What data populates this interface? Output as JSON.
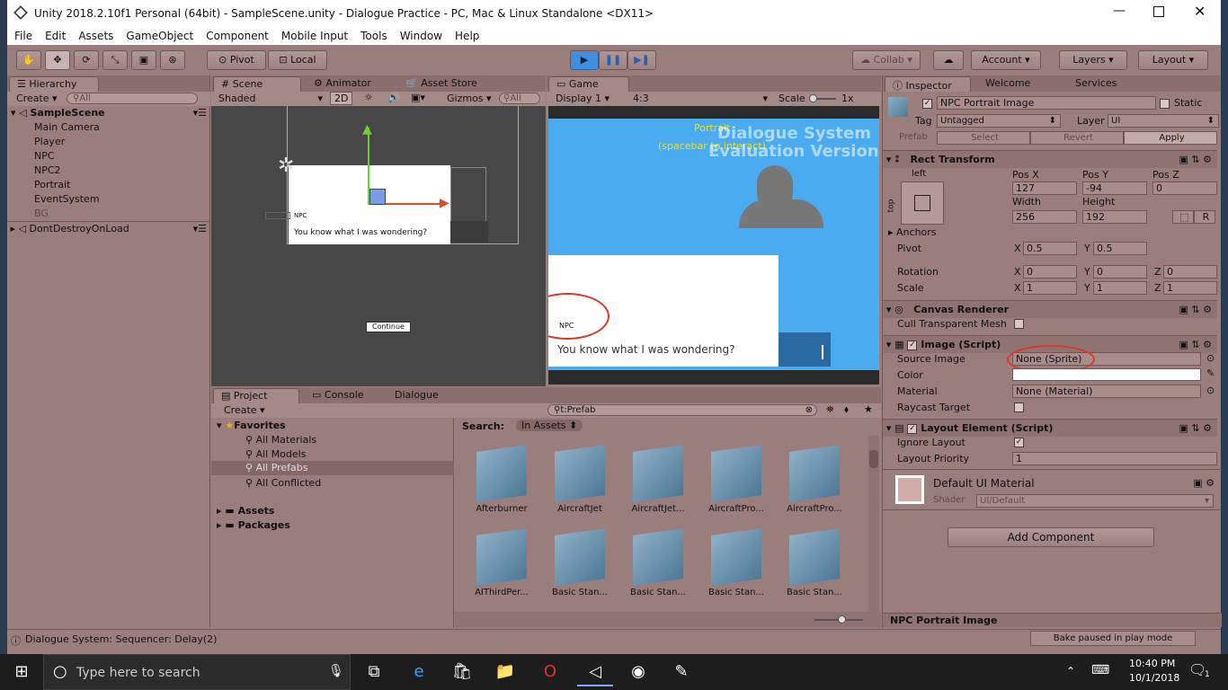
{
  "window": {
    "title": "Unity 2018.2.10f1 Personal (64bit) - SampleScene.unity - Dialogue Practice - PC, Mac & Linux Standalone <DX11>"
  },
  "menu": [
    "File",
    "Edit",
    "Assets",
    "GameObject",
    "Component",
    "Mobile Input",
    "Tools",
    "Window",
    "Help"
  ],
  "toolbar": {
    "pivot": "Pivot",
    "local": "Local",
    "collab": "Collab",
    "account": "Account",
    "layers": "Layers",
    "layout": "Layout"
  },
  "hierarchy": {
    "tab": "Hierarchy",
    "create": "Create",
    "search": "All",
    "scene": "SampleScene",
    "items": [
      "Main Camera",
      "Player",
      "NPC",
      "NPC2",
      "Portrait",
      "EventSystem",
      "BG"
    ],
    "dontdestroy": "DontDestroyOnLoad"
  },
  "scene": {
    "tabs": [
      "Scene",
      "Animator",
      "Asset Store"
    ],
    "shaded": "Shaded",
    "mode2d": "2D",
    "gizmos": "Gizmos",
    "search": "All",
    "npc_label": "NPC",
    "dialog_text": "You know what I was wondering?",
    "continue": "Continue"
  },
  "game": {
    "tab": "Game",
    "display": "Display 1",
    "aspect": "4:3",
    "scale_label": "Scale",
    "scale_value": "1x",
    "portrait": "Portrait",
    "hint": "(spacebar to interact)",
    "watermark1": "Dialogue System",
    "watermark2": "Evaluation Version",
    "npc_label": "NPC",
    "dialog_text": "You know what I was wondering?"
  },
  "project": {
    "tabs": [
      "Project",
      "Console",
      "Dialogue"
    ],
    "create": "Create",
    "search": "t:Prefab",
    "search_label": "Search:",
    "search_scope": "In Assets",
    "favorites": "Favorites",
    "fav_items": [
      "All Materials",
      "All Models",
      "All Prefabs",
      "All Conflicted"
    ],
    "assets": "Assets",
    "packages": "Packages",
    "grid": [
      "Afterburner",
      "AircraftJet",
      "AircraftJet...",
      "AircraftPro...",
      "AircraftPro...",
      "AIThirdPer...",
      "Basic Stan...",
      "Basic Stan...",
      "Basic Stan...",
      "Basic Stan..."
    ]
  },
  "inspector": {
    "tabs": [
      "Inspector",
      "Welcome",
      "Services"
    ],
    "name": "NPC Portrait Image",
    "static": "Static",
    "tag_label": "Tag",
    "tag": "Untagged",
    "layer_label": "Layer",
    "layer": "UI",
    "prefab": "Prefab",
    "select": "Select",
    "revert": "Revert",
    "apply": "Apply",
    "rect": {
      "title": "Rect Transform",
      "anchor_h": "left",
      "anchor_v": "top",
      "posx_label": "Pos X",
      "posy_label": "Pos Y",
      "posz_label": "Pos Z",
      "posx": "127",
      "posy": "-94",
      "posz": "0",
      "width_label": "Width",
      "height_label": "Height",
      "width": "256",
      "height": "192",
      "anchors": "Anchors",
      "pivot": "Pivot",
      "pivot_x": "0.5",
      "pivot_y": "0.5",
      "rotation": "Rotation",
      "rot_x": "0",
      "rot_y": "0",
      "rot_z": "0",
      "scale": "Scale",
      "scale_x": "1",
      "scale_y": "1",
      "scale_z": "1",
      "r": "R"
    },
    "canvas": {
      "title": "Canvas Renderer",
      "cull": "Cull Transparent Mesh"
    },
    "image": {
      "title": "Image (Script)",
      "source_label": "Source Image",
      "source": "None (Sprite)",
      "color_label": "Color",
      "material_label": "Material",
      "material": "None (Material)",
      "raycast": "Raycast Target"
    },
    "layout": {
      "title": "Layout Element (Script)",
      "ignore": "Ignore Layout",
      "priority_label": "Layout Priority",
      "priority": "1"
    },
    "material": {
      "title": "Default UI Material",
      "shader_label": "Shader",
      "shader": "UI/Default"
    },
    "add_component": "Add Component",
    "footer": "NPC Portrait Image"
  },
  "status": {
    "message": "Dialogue System: Sequencer: Delay(2)",
    "bake": "Bake paused in play mode"
  },
  "taskbar": {
    "search": "Type here to search",
    "time": "10:40 PM",
    "date": "10/1/2018",
    "notif": "1"
  },
  "axis": {
    "x": "X",
    "y": "Y",
    "z": "Z"
  },
  "colors": {
    "unity_bg": "#9a7e7b",
    "game_sky": "#4aabf0",
    "annotation": "#d83a2a"
  }
}
